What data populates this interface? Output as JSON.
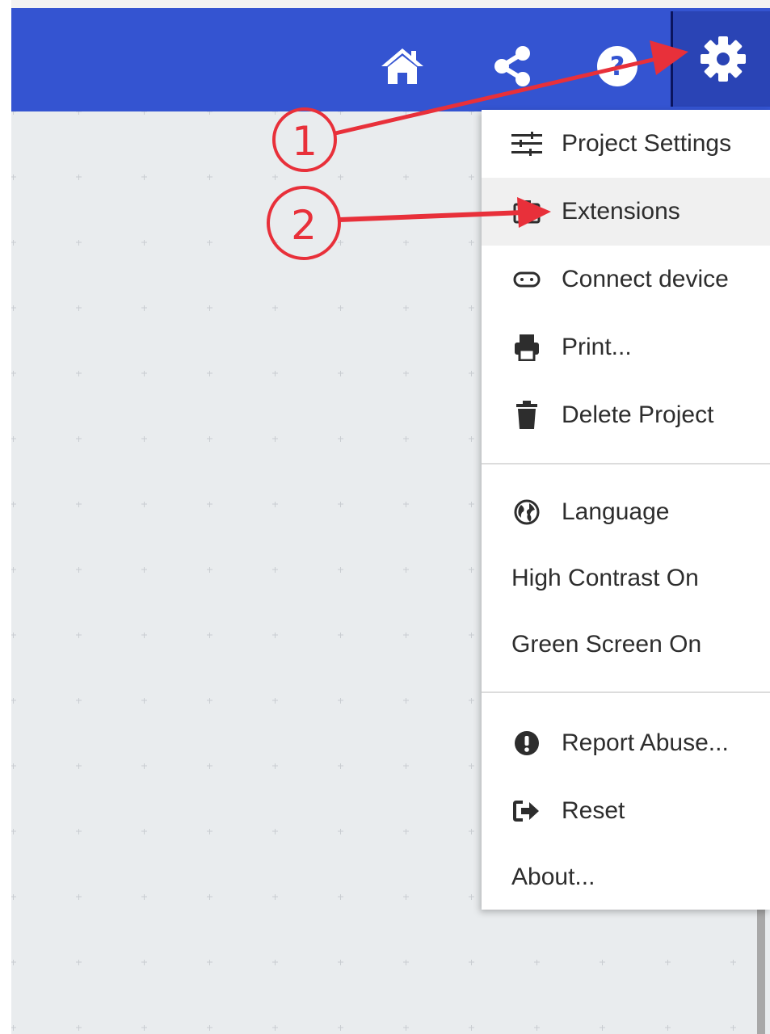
{
  "header": {
    "icons": [
      "home-icon",
      "share-icon",
      "help-icon",
      "gear-icon"
    ],
    "background_color": "#3454d1",
    "settings_background_color": "#2a44b5"
  },
  "menu": {
    "items": [
      {
        "label": "Project Settings",
        "icon": "sliders-icon"
      },
      {
        "label": "Extensions",
        "icon": "puzzle-icon",
        "highlighted": true
      },
      {
        "label": "Connect device",
        "icon": "usb-icon"
      },
      {
        "label": "Print...",
        "icon": "printer-icon"
      },
      {
        "label": "Delete Project",
        "icon": "trash-icon"
      },
      {
        "label": "Language",
        "icon": "globe-icon"
      },
      {
        "label": "High Contrast On"
      },
      {
        "label": "Green Screen On"
      },
      {
        "label": "Report Abuse...",
        "icon": "exclamation-circle-icon"
      },
      {
        "label": "Reset",
        "icon": "sign-out-icon"
      },
      {
        "label": "About..."
      }
    ]
  },
  "annotations": {
    "markers": [
      "1",
      "2"
    ],
    "color": "#e8303a"
  }
}
